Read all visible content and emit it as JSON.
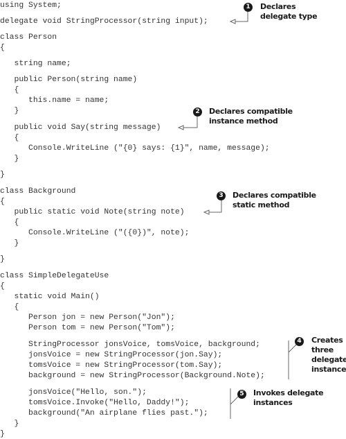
{
  "code_lines": [
    "using System;",
    "delegate void StringProcessor(string input);",
    "class Person",
    "{",
    "   string name;",
    "   public Person(string name)",
    "   {",
    "      this.name = name;",
    "   }",
    "   public void Say(string message)",
    "   {",
    "      Console.WriteLine (\"{0} says: {1}\", name, message);",
    "   }",
    "}",
    "class Background",
    "{",
    "   public static void Note(string note)",
    "   {",
    "      Console.WriteLine (\"({0})\", note);",
    "   }",
    "}",
    "class SimpleDelegateUse",
    "{",
    "   static void Main()",
    "   {",
    "      Person jon = new Person(\"Jon\");",
    "      Person tom = new Person(\"Tom\");",
    "      StringProcessor jonsVoice, tomsVoice, background;",
    "      jonsVoice = new StringProcessor(jon.Say);",
    "      tomsVoice = new StringProcessor(tom.Say);",
    "      background = new StringProcessor(Background.Note);",
    "      jonsVoice(\"Hello, son.\");",
    "      tomsVoice.Invoke(\"Hello, Daddy!\");",
    "      background(\"An airplane flies past.\");",
    "   }",
    "}"
  ],
  "annotations": [
    {
      "number": "1",
      "line1": "Declares",
      "line2": "delegate type",
      "line3": "",
      "line4": ""
    },
    {
      "number": "2",
      "line1": "Declares compatible",
      "line2": "instance method",
      "line3": "",
      "line4": ""
    },
    {
      "number": "3",
      "line1": "Declares compatible",
      "line2": "static method",
      "line3": "",
      "line4": ""
    },
    {
      "number": "4",
      "line1": "Creates",
      "line2": "three",
      "line3": "delegate",
      "line4": "instances"
    },
    {
      "number": "5",
      "line1": "Invokes delegate",
      "line2": "instances",
      "line3": "",
      "line4": ""
    }
  ],
  "colors": {
    "code_text": "#333333",
    "annotation_text": "#1a1a1a",
    "marker_fill": "#1a1a1a",
    "connector": "#666666"
  }
}
